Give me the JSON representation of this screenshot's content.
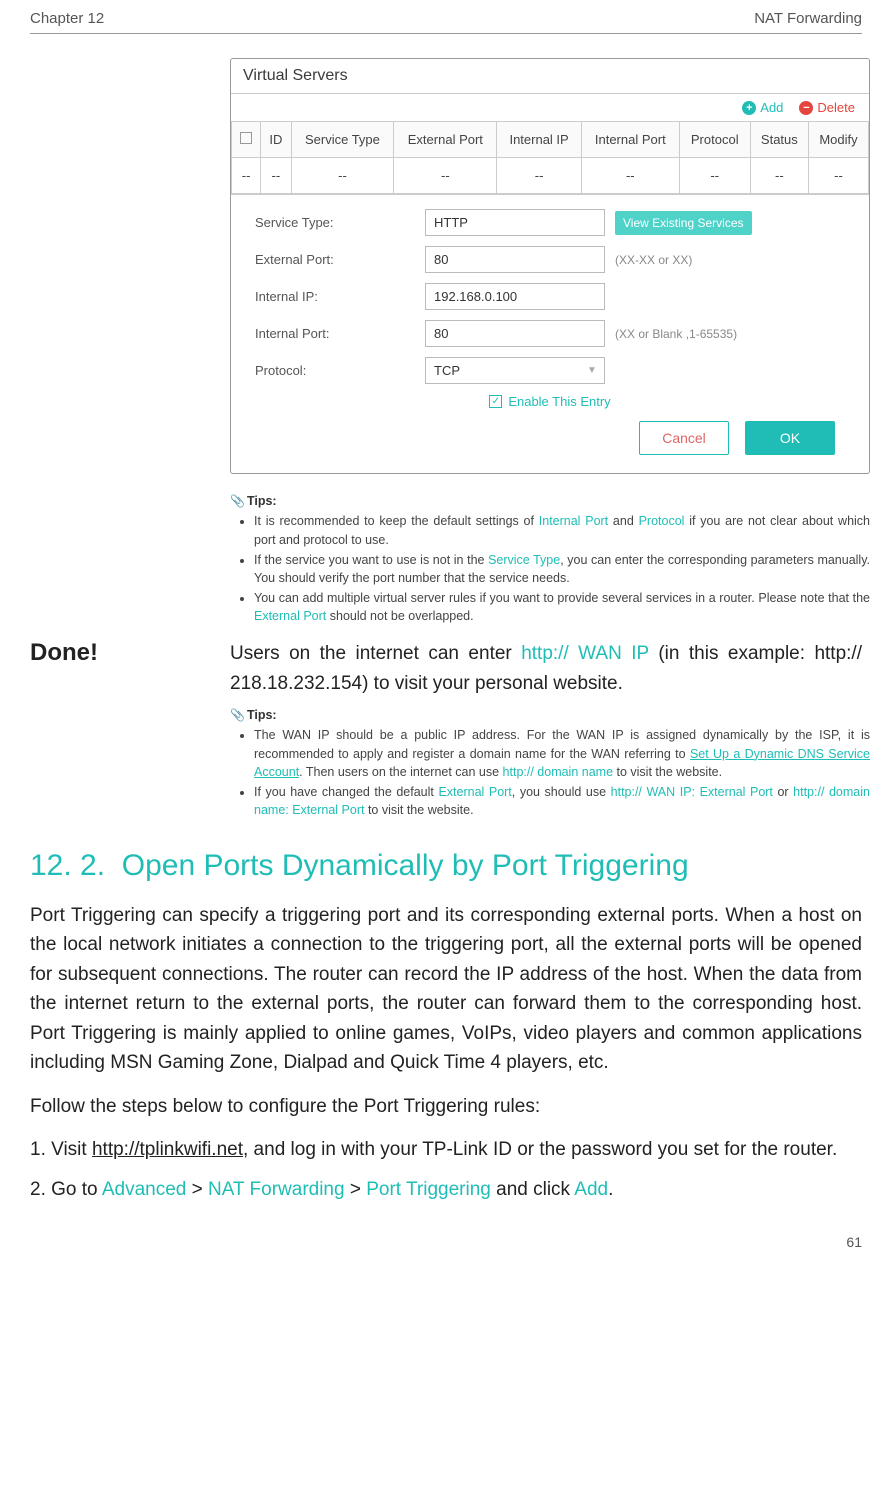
{
  "header": {
    "chapter": "Chapter 12",
    "title": "NAT Forwarding"
  },
  "panel": {
    "title": "Virtual Servers",
    "toolbar": {
      "add": "Add",
      "del": "Delete"
    },
    "columns": [
      "",
      "ID",
      "Service Type",
      "External Port",
      "Internal IP",
      "Internal Port",
      "Protocol",
      "Status",
      "Modify"
    ],
    "empty_row": [
      "--",
      "--",
      "--",
      "--",
      "--",
      "--",
      "--",
      "--",
      "--"
    ],
    "form": {
      "service_type_label": "Service Type:",
      "service_type_value": "HTTP",
      "view_btn": "View Existing Services",
      "ext_port_label": "External Port:",
      "ext_port_value": "80",
      "ext_port_hint": "(XX-XX or XX)",
      "int_ip_label": "Internal IP:",
      "int_ip_value": "192.168.0.100",
      "int_port_label": "Internal Port:",
      "int_port_value": "80",
      "int_port_hint": "(XX or Blank ,1-65535)",
      "protocol_label": "Protocol:",
      "protocol_value": "TCP",
      "enable_label": "Enable This Entry",
      "cancel": "Cancel",
      "ok": "OK"
    }
  },
  "tips1": {
    "heading": "Tips:",
    "items": [
      {
        "pre": "It is recommended to keep the default settings of ",
        "t1": "Internal Port",
        "mid": " and ",
        "t2": "Protocol",
        "post": " if you are not clear about which port and protocol to use."
      },
      {
        "pre": "If the service you want to use is not in the ",
        "t1": "Service Type",
        "post": ", you can enter the corresponding parameters manually. You should verify the port number that the service needs."
      },
      {
        "pre": "You can add multiple virtual server rules if you want to provide several services in a router. Please note that the ",
        "t1": "External Port",
        "post": " should not be overlapped."
      }
    ]
  },
  "done": {
    "label": "Done!",
    "line_pre": "Users on the internet can enter ",
    "line_teal": "http:// WAN IP",
    "line_post": " (in this example: http:// 218.18.232.154) to visit your personal website."
  },
  "tips2": {
    "heading": "Tips:",
    "items": [
      {
        "pre": "The WAN IP should be a public IP address. For the WAN IP is assigned dynamically by the ISP, it is recommended to apply and register a domain name for the WAN referring to ",
        "link": "Set Up a Dynamic DNS Service Account",
        "mid": ". Then users on the internet can use ",
        "t1": "http:// domain name",
        "post": " to visit the website."
      },
      {
        "pre": "If you have changed the default ",
        "t1": "External Port",
        "mid": ", you should use ",
        "t2": "http:// WAN IP: External Port",
        "mid2": " or ",
        "t3": "http:// domain name: External Port",
        "post": " to visit the website."
      }
    ]
  },
  "section": {
    "num": "12. 2.",
    "title": "Open Ports Dynamically by Port Triggering",
    "p1": "Port Triggering can specify a triggering port and its corresponding external ports. When a host on the local network initiates a connection to the triggering port, all the external ports will be opened for subsequent connections. The router can record the IP address of the host. When the data from the internet return to the external ports, the router can forward them to the corresponding host. Port Triggering is mainly applied to online games, VoIPs, video players and common applications including MSN Gaming Zone, Dialpad and Quick Time 4 players, etc.",
    "p2": "Follow the steps below to configure the Port Triggering rules:",
    "step1_pre": "1. Visit ",
    "step1_link": "http://tplinkwifi.net",
    "step1_post": ", and log in with your TP-Link ID or the password you set for the router.",
    "step2_pre": "2. Go to ",
    "step2_a": "Advanced",
    "step2_s1": " > ",
    "step2_b": "NAT Forwarding",
    "step2_s2": " > ",
    "step2_c": "Port Triggering",
    "step2_mid": " and click ",
    "step2_d": "Add",
    "step2_post": "."
  },
  "page_number": "61"
}
